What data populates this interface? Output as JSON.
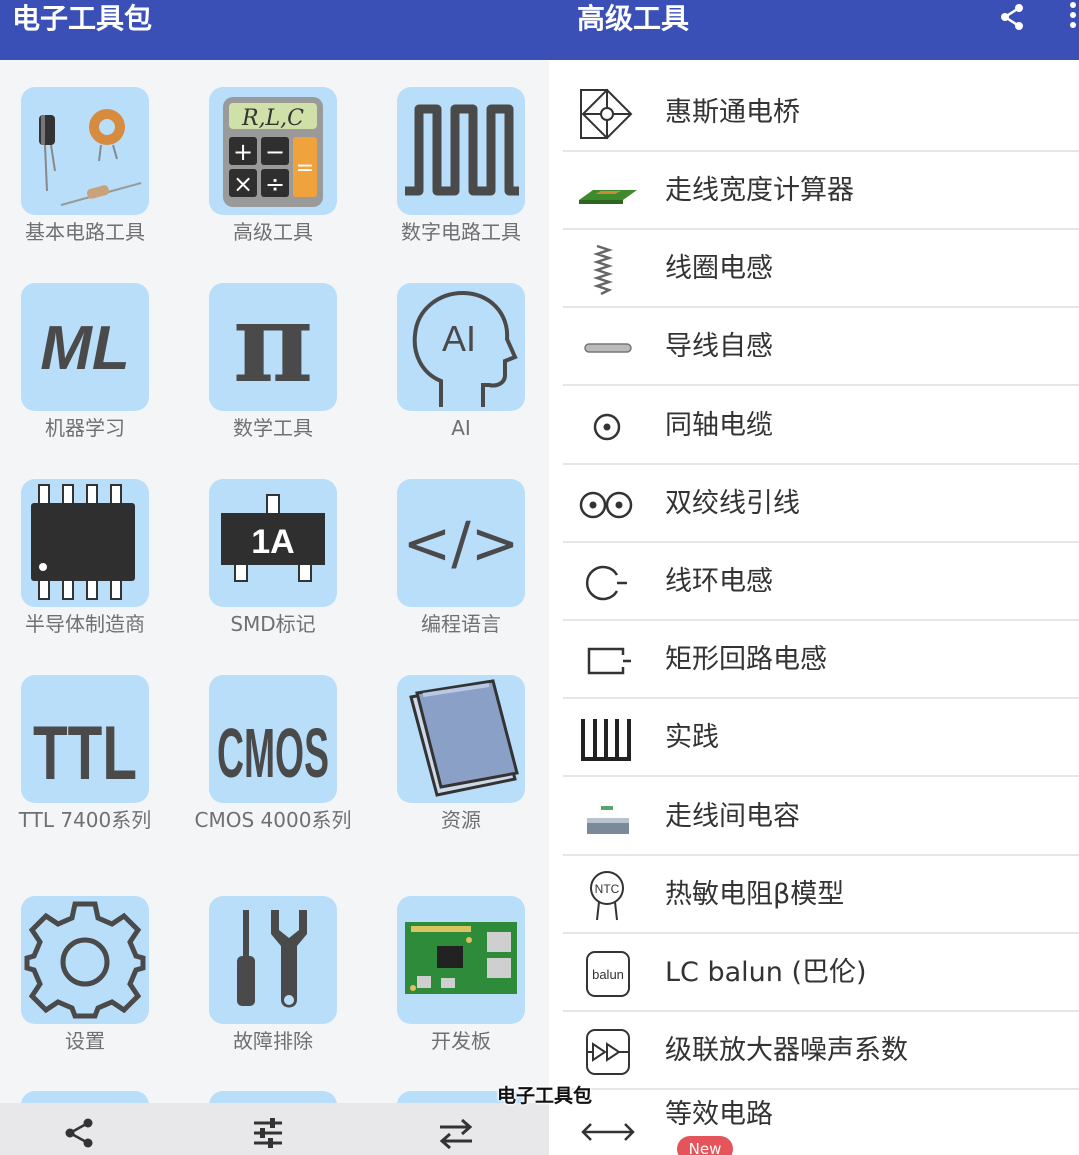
{
  "left": {
    "title": "电子工具包",
    "tiles": [
      {
        "label": "基本电路工具",
        "icon": "components-icon"
      },
      {
        "label": "高级工具",
        "icon": "calculator-icon"
      },
      {
        "label": "数字电路工具",
        "icon": "square-wave-icon"
      },
      {
        "label": "机器学习",
        "icon": "ml-icon"
      },
      {
        "label": "数学工具",
        "icon": "pi-icon"
      },
      {
        "label": "AI",
        "icon": "ai-head-icon"
      },
      {
        "label": "半导体制造商",
        "icon": "chip-icon"
      },
      {
        "label": "SMD标记",
        "icon": "smd-icon"
      },
      {
        "label": "编程语言",
        "icon": "code-icon"
      },
      {
        "label": "TTL 7400系列",
        "icon": "ttl-icon"
      },
      {
        "label": "CMOS 4000系列",
        "icon": "cmos-icon"
      },
      {
        "label": "资源",
        "icon": "book-icon"
      },
      {
        "label": "设置",
        "icon": "gear-icon"
      },
      {
        "label": "故障排除",
        "icon": "tools-icon"
      },
      {
        "label": "开发板",
        "icon": "board-icon"
      }
    ],
    "icon_text": {
      "rlc": "R,L,C",
      "ml": "ML",
      "pi": "π",
      "ai": "AI",
      "smd": "1A",
      "code": "</>",
      "ttl": "TTL",
      "cmos": "CMOS"
    },
    "bottom_nav": [
      "share-icon",
      "sliders-icon",
      "swap-icon"
    ]
  },
  "right": {
    "title": "高级工具",
    "items": [
      {
        "label": "惠斯通电桥",
        "icon": "bridge-icon"
      },
      {
        "label": "走线宽度计算器",
        "icon": "pcb-trace-icon"
      },
      {
        "label": "线圈电感",
        "icon": "coil-icon"
      },
      {
        "label": "导线自感",
        "icon": "wire-icon"
      },
      {
        "label": "同轴电缆",
        "icon": "coax-icon"
      },
      {
        "label": "双绞线引线",
        "icon": "twisted-pair-icon"
      },
      {
        "label": "线环电感",
        "icon": "loop-icon"
      },
      {
        "label": "矩形回路电感",
        "icon": "rect-loop-icon"
      },
      {
        "label": "实践",
        "icon": "practice-icon"
      },
      {
        "label": "走线间电容",
        "icon": "trace-capacitance-icon"
      },
      {
        "label": "热敏电阻β模型",
        "icon": "ntc-icon"
      },
      {
        "label": "LC balun (巴伦)",
        "icon": "balun-icon"
      },
      {
        "label": "级联放大器噪声系数",
        "icon": "amplifier-icon"
      },
      {
        "label": "等效电路",
        "icon": "double-arrow-icon"
      }
    ],
    "icon_text": {
      "ntc": "NTC",
      "balun": "balun"
    },
    "new_badge": "New"
  },
  "caption": "电子工具包",
  "colors": {
    "appbar": "#3a50b7",
    "tile": "#b9defa",
    "badge": "#e5535b"
  }
}
